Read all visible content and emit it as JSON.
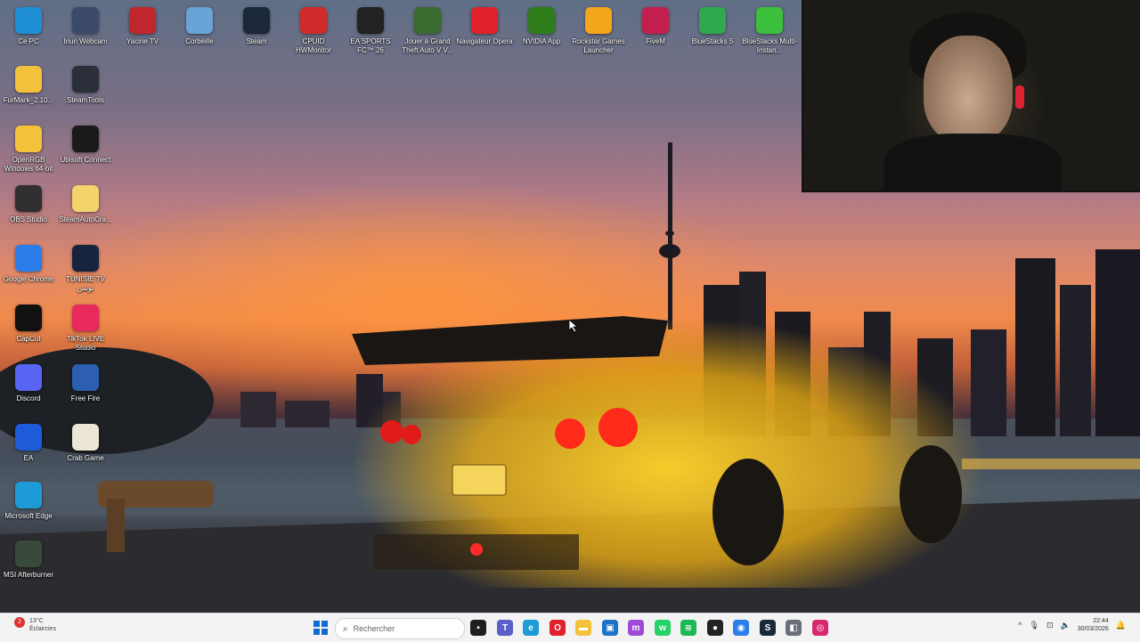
{
  "desktop_icons": [
    {
      "label": "Ce PC",
      "icon": "computer-icon",
      "color": "#1e8fd6"
    },
    {
      "label": "Iriun Webcam",
      "icon": "webcam-icon",
      "color": "#3b4a6b"
    },
    {
      "label": "Yacine TV",
      "icon": "tv-icon",
      "color": "#c0262d"
    },
    {
      "label": "Corbeille",
      "icon": "recycle-bin-icon",
      "color": "#6aa3d6"
    },
    {
      "label": "Steam",
      "icon": "steam-icon",
      "color": "#1b2838"
    },
    {
      "label": "CPUID HWMonitor",
      "icon": "hwmonitor-icon",
      "color": "#d12a2a"
    },
    {
      "label": "EA SPORTS FC™ 26",
      "icon": "ea-fc-icon",
      "color": "#222222"
    },
    {
      "label": "Jouer à Grand Theft Auto V V...",
      "icon": "gta-icon",
      "color": "#3a6b2f"
    },
    {
      "label": "Navigateur Opera",
      "icon": "opera-icon",
      "color": "#e0202a"
    },
    {
      "label": "NVIDIA App",
      "icon": "nvidia-icon",
      "color": "#2f7d1a"
    },
    {
      "label": "Rockstar Games Launcher",
      "icon": "rockstar-icon",
      "color": "#f3a51b"
    },
    {
      "label": "FiveM",
      "icon": "fivem-icon",
      "color": "#c21f4e"
    },
    {
      "label": "BlueStacks 5",
      "icon": "bluestacks-icon",
      "color": "#2fa84f"
    },
    {
      "label": "BlueStacks Multi-Instan...",
      "icon": "bluestacks-multi-icon",
      "color": "#3cbf3c"
    },
    {
      "label": "FurMark_2.10...",
      "icon": "folder-icon",
      "color": "#f3c23a"
    },
    {
      "label": "SteamTools",
      "icon": "steamtools-icon",
      "color": "#2a2f3a"
    },
    {
      "label": "OpenRGB Windows 64-bit",
      "icon": "folder-icon",
      "color": "#f3c23a"
    },
    {
      "label": "Ubisoft Connect",
      "icon": "ubisoft-icon",
      "color": "#1a1a1a"
    },
    {
      "label": "OBS Studio",
      "icon": "obs-icon",
      "color": "#302e31"
    },
    {
      "label": "SteamAutoCra...",
      "icon": "folder-icon",
      "color": "#f3d46a"
    },
    {
      "label": "Google Chrome",
      "icon": "chrome-icon",
      "color": "#2b7de9"
    },
    {
      "label": "TUNISIE TV تونس",
      "icon": "tunisie-tv-icon",
      "color": "#16243f"
    },
    {
      "label": "CapCut",
      "icon": "capcut-icon",
      "color": "#111111"
    },
    {
      "label": "TikTok LIVE Studio",
      "icon": "tiktok-icon",
      "color": "#e8295b"
    },
    {
      "label": "Discord",
      "icon": "discord-icon",
      "color": "#5865f2"
    },
    {
      "label": "Free Fire",
      "icon": "free-fire-icon",
      "color": "#2c5fb0"
    },
    {
      "label": "EA",
      "icon": "ea-icon",
      "color": "#1e5bd8"
    },
    {
      "label": "Crab Game",
      "icon": "crab-game-icon",
      "color": "#ece6d4"
    },
    {
      "label": "Microsoft Edge",
      "icon": "edge-icon",
      "color": "#1c9bd6"
    },
    {
      "label": "MSI Afterburner",
      "icon": "msi-afterburner-icon",
      "color": "#3a4a3a"
    }
  ],
  "taskbar": {
    "weather_temp": "13°C",
    "weather_desc": "Éclaircies",
    "weather_badge": "2",
    "search_placeholder": "Rechercher",
    "apps": [
      {
        "icon": "file-explorer-taskbar-icon",
        "color": "#1f1f1f",
        "glyph": "▪"
      },
      {
        "icon": "teams-taskbar-icon",
        "color": "#5b5fc7",
        "glyph": "T"
      },
      {
        "icon": "edge-taskbar-icon",
        "color": "#1c9bd6",
        "glyph": "e"
      },
      {
        "icon": "opera-taskbar-icon",
        "color": "#e0202a",
        "glyph": "O"
      },
      {
        "icon": "folder-taskbar-icon",
        "color": "#f3c23a",
        "glyph": "▬"
      },
      {
        "icon": "store-taskbar-icon",
        "color": "#1a73c8",
        "glyph": "▣"
      },
      {
        "icon": "messenger-taskbar-icon",
        "color": "#a04ad8",
        "glyph": "m"
      },
      {
        "icon": "whatsapp-taskbar-icon",
        "color": "#25d366",
        "glyph": "w"
      },
      {
        "icon": "spotify-taskbar-icon",
        "color": "#1db954",
        "glyph": "≋"
      },
      {
        "icon": "github-taskbar-icon",
        "color": "#222222",
        "glyph": "●"
      },
      {
        "icon": "chrome-taskbar-icon",
        "color": "#2b7de9",
        "glyph": "◉"
      },
      {
        "icon": "steam-taskbar-icon",
        "color": "#1b2838",
        "glyph": "S"
      },
      {
        "icon": "app-taskbar-icon",
        "color": "#6a6f7a",
        "glyph": "◧"
      },
      {
        "icon": "instagram-taskbar-icon",
        "color": "#d6296f",
        "glyph": "◎"
      }
    ],
    "clock_time": "22:44",
    "clock_date": "30/03/2026"
  }
}
